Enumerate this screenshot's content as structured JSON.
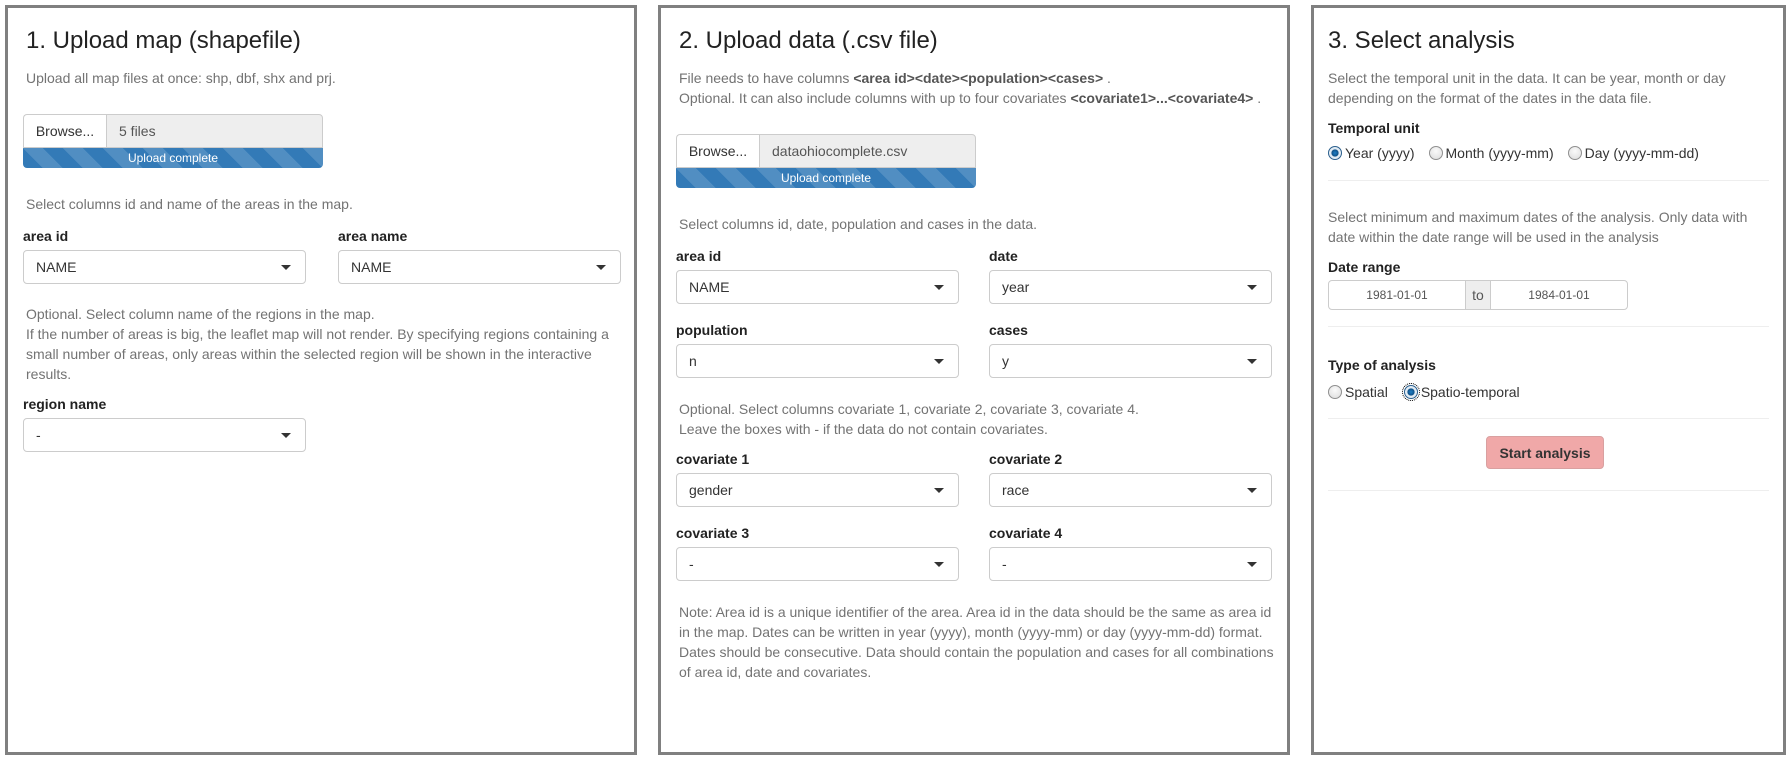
{
  "panel1": {
    "title": "1. Upload map (shapefile)",
    "help": "Upload all map files at once: shp, dbf, shx and prj.",
    "file_input": {
      "browse_label": "Browse...",
      "value": "5 files",
      "progress_label": "Upload complete",
      "progress_percent": 100
    },
    "columns_help": "Select columns id and name of the areas in the map.",
    "area_id": {
      "label": "area id",
      "value": "NAME"
    },
    "area_name": {
      "label": "area name",
      "value": "NAME"
    },
    "region_help_1": "Optional. Select column name of the regions in the map.",
    "region_help_2": "If the number of areas is big, the leaflet map will not render. By specifying regions containing a small number of areas, only areas within the selected region will be shown in the interactive results.",
    "region_name": {
      "label": "region name",
      "value": "-"
    }
  },
  "panel2": {
    "title": "2. Upload data (.csv file)",
    "help_1_prefix": "File needs to have columns ",
    "help_1_bold": "<area id><date><population><cases>",
    "help_1_suffix": " .",
    "help_2_prefix": "Optional. It can also include columns with up to four covariates ",
    "help_2_bold": "<covariate1>...<covariate4>",
    "help_2_suffix": " .",
    "file_input": {
      "browse_label": "Browse...",
      "value": "dataohiocomplete.csv",
      "progress_label": "Upload complete",
      "progress_percent": 100
    },
    "columns_help": "Select columns id, date, population and cases in the data.",
    "area_id": {
      "label": "area id",
      "value": "NAME"
    },
    "date": {
      "label": "date",
      "value": "year"
    },
    "population": {
      "label": "population",
      "value": "n"
    },
    "cases": {
      "label": "cases",
      "value": "y"
    },
    "cov_help_1": "Optional. Select columns covariate 1, covariate 2, covariate 3, covariate 4.",
    "cov_help_2": "Leave the boxes with - if the data do not contain covariates.",
    "covariate1": {
      "label": "covariate 1",
      "value": "gender"
    },
    "covariate2": {
      "label": "covariate 2",
      "value": "race"
    },
    "covariate3": {
      "label": "covariate 3",
      "value": "-"
    },
    "covariate4": {
      "label": "covariate 4",
      "value": "-"
    },
    "note": "Note: Area id is a unique identifier of the area. Area id in the data should be the same as area id in the map. Dates can be written in year (yyyy), month (yyyy-mm) or day (yyyy-mm-dd) format. Dates should be consecutive. Data should contain the population and cases for all combinations of area id, date and covariates."
  },
  "panel3": {
    "title": "3. Select analysis",
    "temporal_help": "Select the temporal unit in the data. It can be year, month or day depending on the format of the dates in the data file.",
    "temporal_unit": {
      "label": "Temporal unit",
      "options": [
        "Year (yyyy)",
        "Month (yyyy-mm)",
        "Day (yyyy-mm-dd)"
      ],
      "selected": "Year (yyyy)"
    },
    "date_help": "Select minimum and maximum dates of the analysis. Only data with date within the date range will be used in the analysis",
    "date_range": {
      "label": "Date range",
      "start": "1981-01-01",
      "separator": "to",
      "end": "1984-01-01"
    },
    "analysis_type": {
      "label": "Type of analysis",
      "options": [
        "Spatial",
        "Spatio-temporal"
      ],
      "selected": "Spatio-temporal"
    },
    "start_button": "Start analysis",
    "start_button_color": "#f0a8a8"
  },
  "colors": {
    "panel_border": "#808080",
    "progress_bar": "#337ab7",
    "help_text": "#737373"
  }
}
